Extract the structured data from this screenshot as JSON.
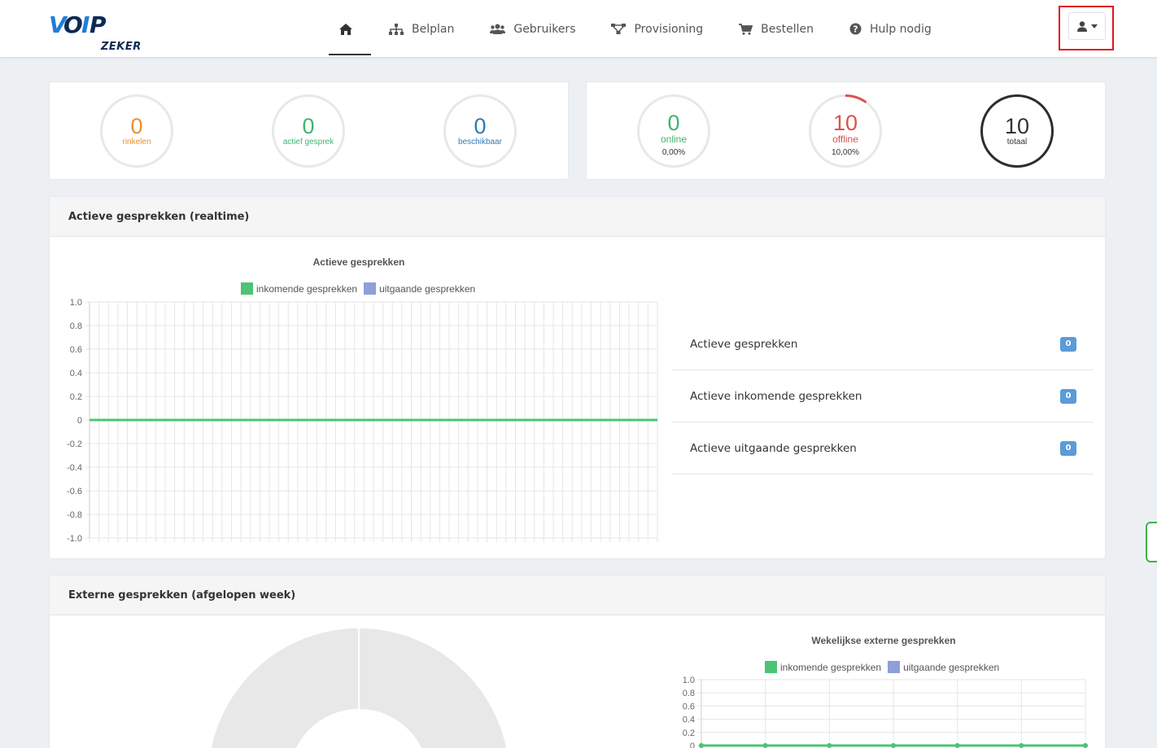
{
  "header": {
    "logo_text": "VOIP ZEKER",
    "nav": [
      {
        "label": "",
        "icon": "home-icon"
      },
      {
        "label": "Belplan",
        "icon": "sitemap-icon"
      },
      {
        "label": "Gebruikers",
        "icon": "users-icon"
      },
      {
        "label": "Provisioning",
        "icon": "network-icon"
      },
      {
        "label": "Bestellen",
        "icon": "cart-icon"
      },
      {
        "label": "Hulp nodig",
        "icon": "question-circle-icon"
      }
    ],
    "user_menu_icon": "user-icon"
  },
  "stats_left": [
    {
      "value": "0",
      "label": "rinkelen",
      "color": "#e8922a"
    },
    {
      "value": "0",
      "label": "actief gesprek",
      "color": "#3fb56e"
    },
    {
      "value": "0",
      "label": "beschikbaar",
      "color": "#2c7bb6"
    }
  ],
  "stats_right": [
    {
      "value": "0",
      "label": "online",
      "pct": "0,00%",
      "color": "#3fb56e"
    },
    {
      "value": "10",
      "label": "offline",
      "pct": "10,00%",
      "color": "#d9534f"
    },
    {
      "value": "10",
      "label": "totaal",
      "color": "#333333"
    }
  ],
  "realtime": {
    "heading": "Actieve gesprekken (realtime)",
    "list": [
      {
        "label": "Actieve gesprekken",
        "count": "0"
      },
      {
        "label": "Actieve inkomende gesprekken",
        "count": "0"
      },
      {
        "label": "Actieve uitgaande gesprekken",
        "count": "0"
      }
    ]
  },
  "weekly": {
    "heading": "Externe gesprekken (afgelopen week)"
  },
  "colors": {
    "incoming": "#4cc474",
    "outgoing": "#8e9fdb",
    "badge": "#5b9bd8",
    "highlight": "#e0141e"
  },
  "chart_data": [
    {
      "type": "line",
      "title": "Actieve gesprekken",
      "series": [
        {
          "name": "inkomende gesprekken",
          "values": [
            0,
            0,
            0,
            0,
            0,
            0,
            0,
            0,
            0,
            0,
            0,
            0,
            0,
            0,
            0,
            0,
            0,
            0,
            0,
            0,
            0,
            0,
            0,
            0,
            0,
            0,
            0,
            0,
            0,
            0,
            0,
            0,
            0,
            0,
            0,
            0,
            0,
            0,
            0,
            0,
            0,
            0,
            0,
            0,
            0,
            0,
            0,
            0,
            0,
            0,
            0,
            0,
            0,
            0,
            0,
            0,
            0,
            0,
            0,
            0
          ]
        },
        {
          "name": "uitgaande gesprekken",
          "values": [
            0,
            0,
            0,
            0,
            0,
            0,
            0,
            0,
            0,
            0,
            0,
            0,
            0,
            0,
            0,
            0,
            0,
            0,
            0,
            0,
            0,
            0,
            0,
            0,
            0,
            0,
            0,
            0,
            0,
            0,
            0,
            0,
            0,
            0,
            0,
            0,
            0,
            0,
            0,
            0,
            0,
            0,
            0,
            0,
            0,
            0,
            0,
            0,
            0,
            0,
            0,
            0,
            0,
            0,
            0,
            0,
            0,
            0,
            0,
            0
          ]
        }
      ],
      "yticks": [
        "1.0",
        "0.8",
        "0.6",
        "0.4",
        "0.2",
        "0",
        "-0.2",
        "-0.4",
        "-0.6",
        "-0.8",
        "-1.0"
      ],
      "ylim": [
        -1,
        1
      ],
      "grid": true,
      "legend": "top"
    },
    {
      "type": "line",
      "title": "Wekelijkse externe gesprekken",
      "series": [
        {
          "name": "inkomende gesprekken",
          "values": [
            0,
            0,
            0,
            0,
            0,
            0,
            0
          ]
        },
        {
          "name": "uitgaande gesprekken",
          "values": [
            0,
            0,
            0,
            0,
            0,
            0,
            0
          ]
        }
      ],
      "yticks": [
        "1.0",
        "0.8",
        "0.6",
        "0.4",
        "0.2",
        "0"
      ],
      "ylim": [
        0,
        1
      ],
      "grid": true,
      "legend": "top"
    },
    {
      "type": "pie",
      "values": [],
      "note_empty": true
    }
  ]
}
